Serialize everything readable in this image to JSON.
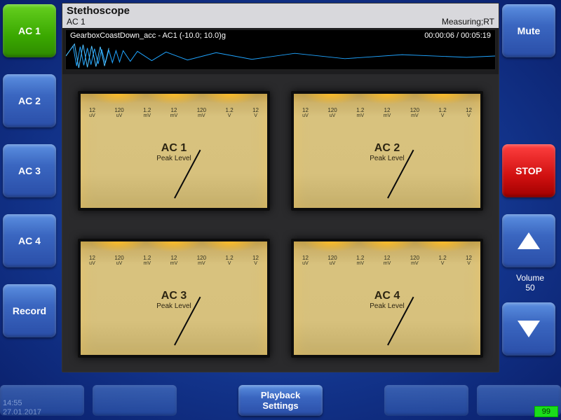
{
  "header": {
    "app_title": "Stethoscope",
    "channel_label": "AC 1",
    "mode_status": "Measuring;RT"
  },
  "waveform": {
    "file_label": "GearboxCoastDown_acc - AC1 (-10.0; 10.0)g",
    "time_position": "00:00:06 / 00:05:19"
  },
  "left_buttons": [
    {
      "label": "AC 1",
      "active": true
    },
    {
      "label": "AC 2",
      "active": false
    },
    {
      "label": "AC 3",
      "active": false
    },
    {
      "label": "AC 4",
      "active": false
    },
    {
      "label": "Record",
      "active": false
    }
  ],
  "right_buttons": {
    "mute": "Mute",
    "stop": "STOP",
    "volume_label": "Volume",
    "volume_value": "50"
  },
  "gauge_scale": [
    {
      "n": "12",
      "u": "uV"
    },
    {
      "n": "120",
      "u": "uV"
    },
    {
      "n": "1.2",
      "u": "mV"
    },
    {
      "n": "12",
      "u": "mV"
    },
    {
      "n": "120",
      "u": "mV"
    },
    {
      "n": "1.2",
      "u": "V"
    },
    {
      "n": "12",
      "u": "V"
    }
  ],
  "gauges": [
    {
      "title": "AC 1",
      "subtitle": "Peak Level",
      "needle_deg": 28
    },
    {
      "title": "AC 2",
      "subtitle": "Peak Level",
      "needle_deg": 28
    },
    {
      "title": "AC 3",
      "subtitle": "Peak Level",
      "needle_deg": 28
    },
    {
      "title": "AC 4",
      "subtitle": "Peak Level",
      "needle_deg": 28
    }
  ],
  "bottom": {
    "playback_label": "Playback Settings",
    "time": "14:55",
    "date": "27.01.2017",
    "battery": "99"
  }
}
